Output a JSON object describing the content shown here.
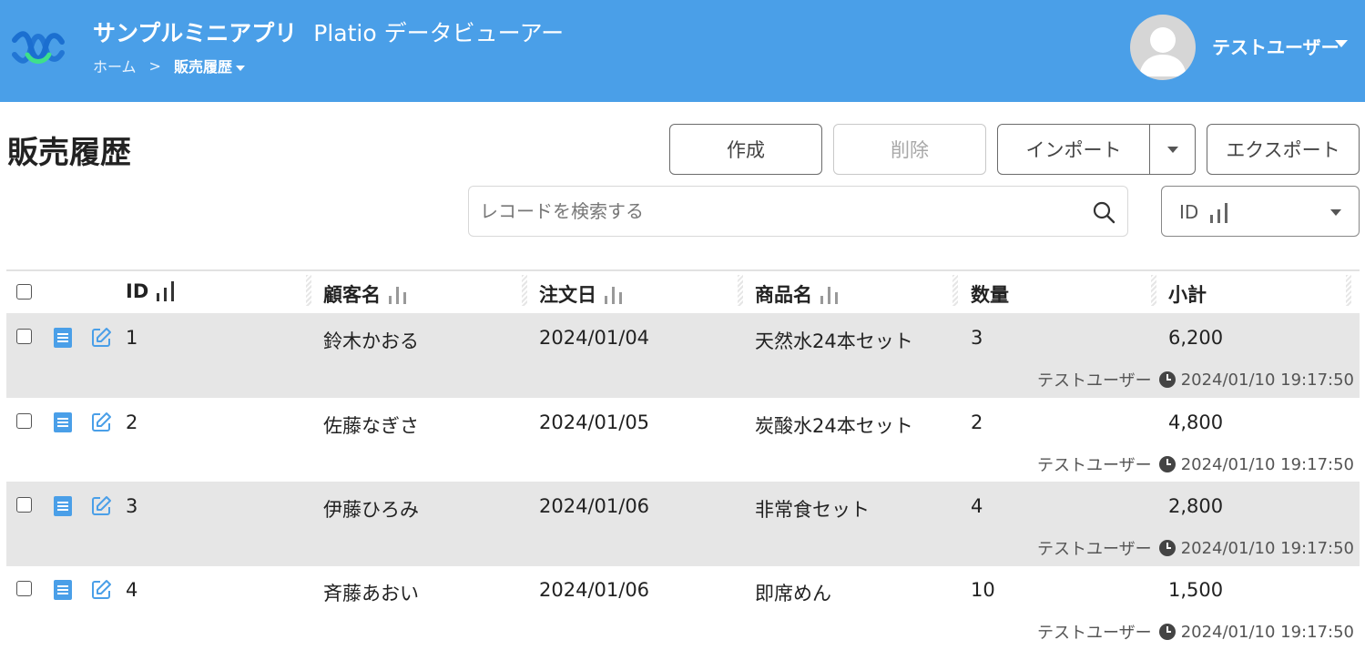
{
  "header": {
    "app_name": "サンプルミニアプリ",
    "app_subtitle": "Platio データビューアー",
    "breadcrumb": {
      "home": "ホーム",
      "separator": ">",
      "current": "販売履歴"
    },
    "user": {
      "name": "テストユーザー"
    },
    "colors": {
      "bar": "#4a9fe8"
    }
  },
  "page": {
    "title": "販売履歴"
  },
  "toolbar": {
    "create_label": "作成",
    "delete_label": "削除",
    "import_label": "インポート",
    "export_label": "エクスポート"
  },
  "search": {
    "placeholder": "レコードを検索する",
    "value": ""
  },
  "sort": {
    "selected": "ID"
  },
  "table": {
    "columns": [
      "ID",
      "顧客名",
      "注文日",
      "商品名",
      "数量",
      "小計"
    ],
    "rows": [
      {
        "id": "1",
        "customer": "鈴木かおる",
        "date": "2024/01/04",
        "product": "天然水24本セット",
        "qty": "3",
        "subtotal": "6,200",
        "updated_by": "テストユーザー",
        "updated_at": "2024/01/10 19:17:50"
      },
      {
        "id": "2",
        "customer": "佐藤なぎさ",
        "date": "2024/01/05",
        "product": "炭酸水24本セット",
        "qty": "2",
        "subtotal": "4,800",
        "updated_by": "テストユーザー",
        "updated_at": "2024/01/10 19:17:50"
      },
      {
        "id": "3",
        "customer": "伊藤ひろみ",
        "date": "2024/01/06",
        "product": "非常食セット",
        "qty": "4",
        "subtotal": "2,800",
        "updated_by": "テストユーザー",
        "updated_at": "2024/01/10 19:17:50"
      },
      {
        "id": "4",
        "customer": "斉藤あおい",
        "date": "2024/01/06",
        "product": "即席めん",
        "qty": "10",
        "subtotal": "1,500",
        "updated_by": "テストユーザー",
        "updated_at": "2024/01/10 19:17:50"
      }
    ]
  },
  "icons": {
    "logo": "platio-logo-icon",
    "avatar": "user-avatar-icon",
    "search": "search-icon",
    "sort": "bar-chart-sort-icon",
    "row_view": "document-icon",
    "row_edit": "edit-icon",
    "timestamp": "clock-icon"
  }
}
